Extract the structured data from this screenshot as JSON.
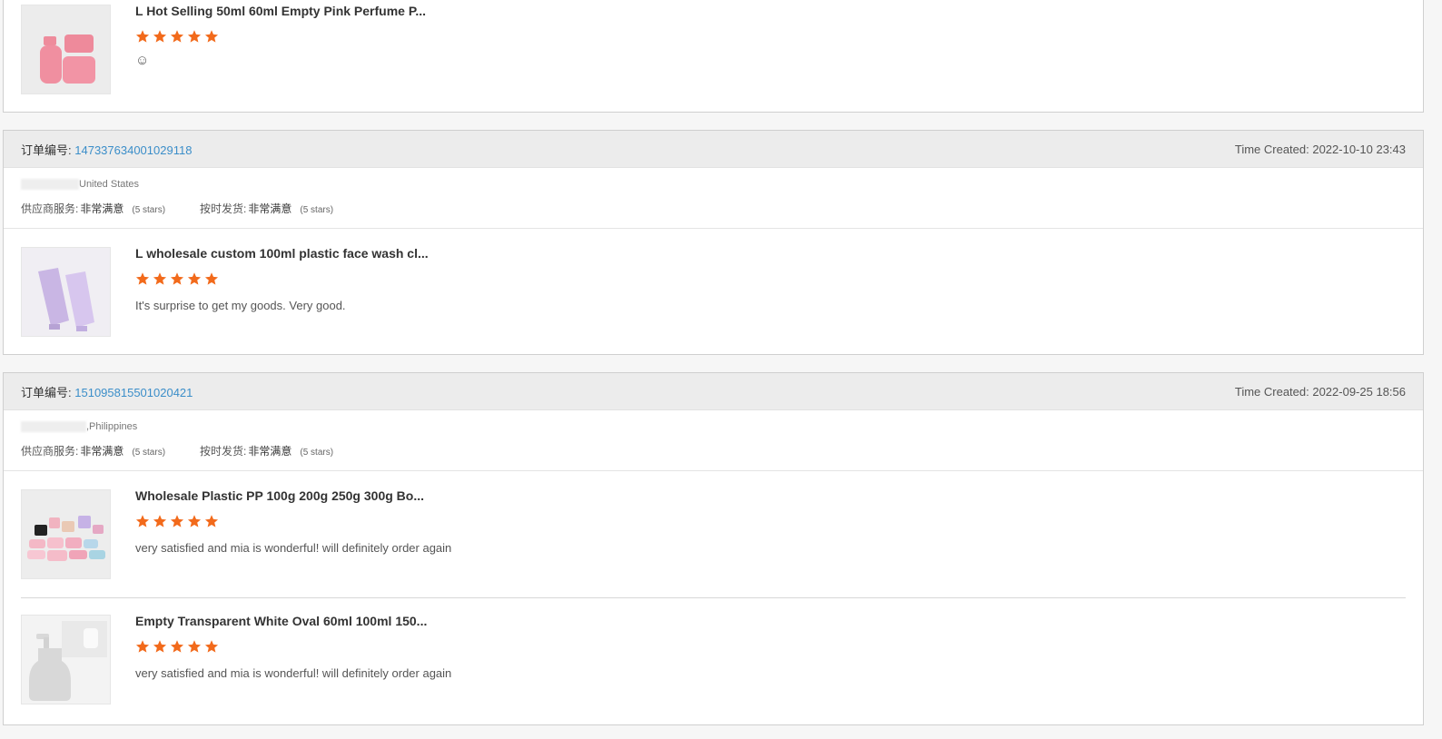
{
  "colors": {
    "accent_link": "#3b8ec9",
    "star": "#f26a1b",
    "header_bg": "#ececec"
  },
  "icons": {
    "star": "star-icon"
  },
  "top_item": {
    "title": "L Hot Selling 50ml 60ml Empty Pink Perfume P...",
    "rating": 5,
    "comment": "☺"
  },
  "orders": [
    {
      "order_label": "订单编号:",
      "order_number": "147337634001029118",
      "time_created": "Time Created: 2022-10-10 23:43",
      "location": "United States",
      "supplier_service_label": "供应商服务:",
      "supplier_service_value": "非常满意",
      "supplier_service_stars": "(5 stars)",
      "on_time_label": "按时发货:",
      "on_time_value": "非常满意",
      "on_time_stars": "(5 stars)",
      "items": [
        {
          "title": "L wholesale custom 100ml plastic face wash cl...",
          "rating": 5,
          "comment": "It's surprise to get my goods. Very good."
        }
      ]
    },
    {
      "order_label": "订单编号:",
      "order_number": "151095815501020421",
      "time_created": "Time Created: 2022-09-25 18:56",
      "location": ",Philippines",
      "supplier_service_label": "供应商服务:",
      "supplier_service_value": "非常满意",
      "supplier_service_stars": "(5 stars)",
      "on_time_label": "按时发货:",
      "on_time_value": "非常满意",
      "on_time_stars": "(5 stars)",
      "items": [
        {
          "title": "Wholesale Plastic PP 100g 200g 250g 300g Bo...",
          "rating": 5,
          "comment": "very satisfied and mia is wonderful! will definitely order again"
        },
        {
          "title": "Empty Transparent White Oval 60ml 100ml 150...",
          "rating": 5,
          "comment": "very satisfied and mia is wonderful! will definitely order again"
        }
      ]
    }
  ]
}
